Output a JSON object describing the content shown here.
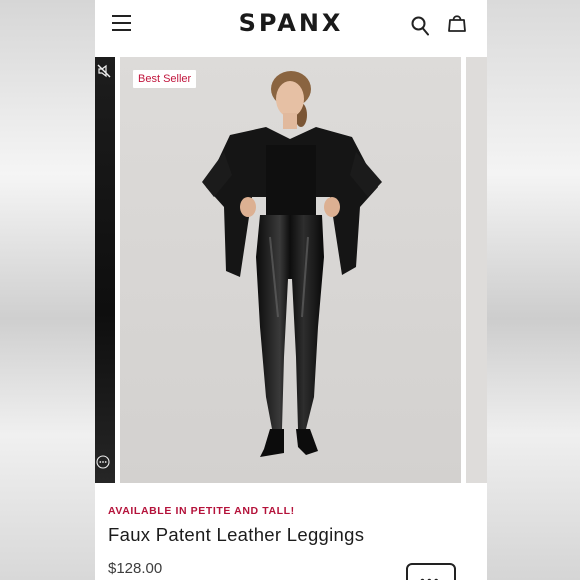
{
  "header": {
    "brand": "SPANX",
    "icons": [
      "menu-icon",
      "search-icon",
      "bag-icon"
    ]
  },
  "gallery": {
    "badge": "Best Seller",
    "icons": [
      "mute-icon",
      "more-circle-icon"
    ]
  },
  "product": {
    "availability": "AVAILABLE IN PETITE AND TALL!",
    "title": "Faux Patent Leather Leggings",
    "price": "$128.00",
    "more_button_label": "•••"
  },
  "colors": {
    "accent": "#b4123a",
    "text": "#1c1c1c"
  }
}
